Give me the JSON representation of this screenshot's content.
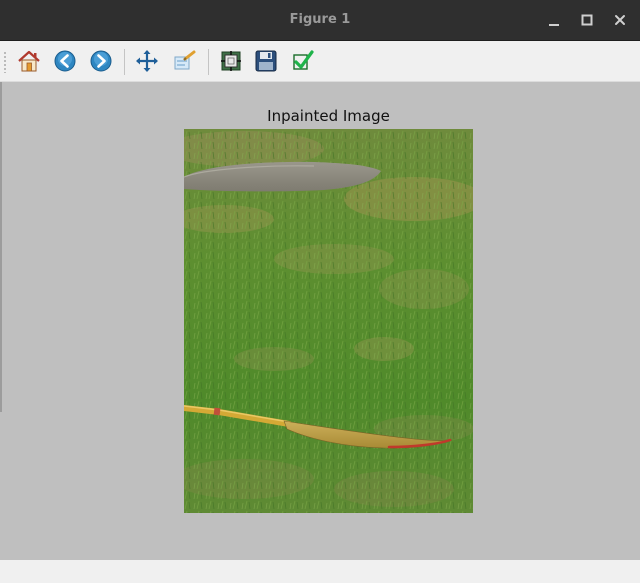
{
  "window": {
    "title": "Figure 1",
    "controls": {
      "minimize_icon": "minimize-icon",
      "maximize_icon": "maximize-icon",
      "close_icon": "close-icon"
    }
  },
  "toolbar": {
    "tools": [
      {
        "name": "home-button",
        "icon": "home-icon"
      },
      {
        "name": "back-button",
        "icon": "back-arrow-icon"
      },
      {
        "name": "forward-button",
        "icon": "forward-arrow-icon"
      },
      {
        "name": "pan-button",
        "icon": "pan-move-icon"
      },
      {
        "name": "zoom-button",
        "icon": "zoom-rect-icon"
      },
      {
        "name": "subplots-button",
        "icon": "configure-subplots-icon"
      },
      {
        "name": "save-button",
        "icon": "save-icon"
      },
      {
        "name": "edit-button",
        "icon": "checkmark-icon"
      }
    ]
  },
  "figure": {
    "plot_title": "Inpainted Image",
    "image_description_icon": "photo-grass-paddle"
  },
  "colors": {
    "titlebar": "#2f2f2f",
    "canvas": "#bfbfbf",
    "toolbar": "#f0f0f0",
    "grass": "#5a8a32",
    "stone": "#8c8a80",
    "paddle": "#c2a23c",
    "paddle_tip": "#c0392b"
  }
}
